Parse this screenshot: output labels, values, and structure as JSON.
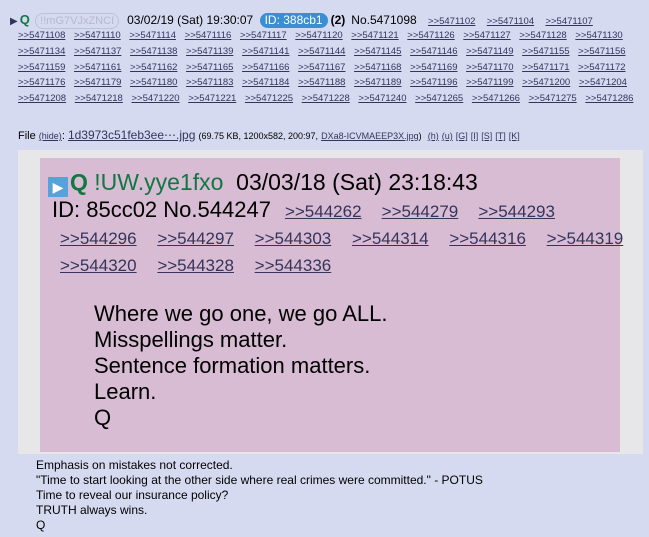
{
  "post": {
    "name": "Q",
    "tripcode": "!!mG7VJxZNCI",
    "datetime": "03/02/19 (Sat) 19:30:07",
    "id_label": "ID: 388cb1",
    "post_count": "(2)",
    "post_no": "No.5471098",
    "header_links": [
      ">>5471102",
      ">>5471104",
      ">>5471107"
    ],
    "reply_links": [
      ">>5471108",
      ">>5471110",
      ">>5471114",
      ">>5471116",
      ">>5471117",
      ">>5471120",
      ">>5471121",
      ">>5471126",
      ">>5471127",
      ">>5471128",
      ">>5471130",
      ">>5471134",
      ">>5471137",
      ">>5471138",
      ">>5471139",
      ">>5471141",
      ">>5471144",
      ">>5471145",
      ">>5471146",
      ">>5471149",
      ">>5471155",
      ">>5471156",
      ">>5471159",
      ">>5471161",
      ">>5471162",
      ">>5471165",
      ">>5471166",
      ">>5471167",
      ">>5471168",
      ">>5471169",
      ">>5471170",
      ">>5471171",
      ">>5471172",
      ">>5471176",
      ">>5471179",
      ">>5471180",
      ">>5471183",
      ">>5471184",
      ">>5471188",
      ">>5471189",
      ">>5471196",
      ">>5471199",
      ">>5471200",
      ">>5471204",
      ">>5471208",
      ">>5471218",
      ">>5471220",
      ">>5471221",
      ">>5471225",
      ">>5471228",
      ">>5471240",
      ">>5471265",
      ">>5471266",
      ">>5471275",
      ">>5471286"
    ],
    "file": {
      "label": "File",
      "hide": "(hide)",
      "name": "1d3973c51feb3ee⋯.jpg",
      "info": "(69.75 KB, 1200x582, 200:97,",
      "orig_name": "DXa8-ICVMAEEP3X.jpg",
      "close_paren": ")",
      "tools": [
        "(h)",
        "(u)",
        "[G]",
        "[I]",
        "[S]",
        "[T]",
        "[K]"
      ]
    },
    "body_lines": [
      "Emphasis on mistakes not corrected.",
      "\"Time to start looking at the other side where real crimes were committed.\" - POTUS",
      "Time to reveal our insurance policy?",
      "TRUTH always wins.",
      "Q"
    ]
  },
  "image": {
    "play_symbol": "▶",
    "name": "Q",
    "tripcode": "!UW.yye1fxo",
    "datetime": "03/03/18 (Sat) 23:18:43",
    "id_no": "ID: 85cc02 No.544247",
    "links_line1": [
      ">>544262",
      ">>544279",
      ">>544293"
    ],
    "links_line2": [
      ">>544296",
      ">>544297",
      ">>544303",
      ">>544314",
      ">>544316",
      ">>544319"
    ],
    "links_line3": [
      ">>544320",
      ">>544328",
      ">>544336"
    ],
    "message": [
      "Where we go one, we go ALL.",
      "Misspellings matter.",
      "Sentence formation matters.",
      "Learn.",
      "Q"
    ]
  },
  "colors": {
    "background": "#d6daf0",
    "name_green": "#117743",
    "link": "#34345c",
    "id_badge": "#3a8fd4",
    "card": "#d8bcd3"
  }
}
